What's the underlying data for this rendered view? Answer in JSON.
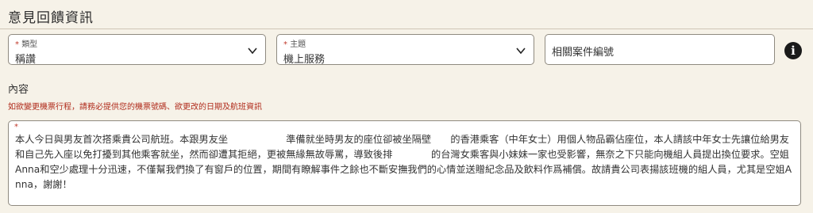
{
  "section": {
    "title": "意見回饋資訊"
  },
  "fields": {
    "type": {
      "required_mark": "*",
      "label": "類型",
      "value": "稱讚"
    },
    "topic": {
      "required_mark": "*",
      "label": "主題",
      "value": "機上服務"
    },
    "case_number": {
      "placeholder": "相關案件編號"
    }
  },
  "icons": {
    "info": "info-circle-icon",
    "dropdown": "chevron-down-icon"
  },
  "content": {
    "label": "內容",
    "hint": "如欲變更機票行程，請務必提供您的機票號碼、欲更改的日期及航班資訊",
    "required_mark": "*",
    "text": "本人今日與男友首次搭乘貴公司航班。本跟男友坐　　　　　　準備就坐時男友的座位卻被坐隔壁　　的香港乘客（中年女士）用個人物品霸佔座位，本人請該中年女士先讓位給男友和自己先入座以免打擾到其他乘客就坐，然而卻遭其拒絕，更被無緣無故辱罵，導致後排　　　　的台灣女乘客與小妹妹一家也受影響，無奈之下只能向機組人員提出換位要求。空姐Anna和空少處理十分迅速，不僅幫我們換了有窗戶的位置，期間有瞭解事件之餘也不斷安撫我們的心情並送贈紀念品及飲料作爲補償。故請貴公司表揚該班機的組人員，尤其是空姐Anna，謝謝！"
  },
  "colors": {
    "required": "#c0392b",
    "hint": "#b02a1a",
    "background": "#f6f2e8"
  }
}
